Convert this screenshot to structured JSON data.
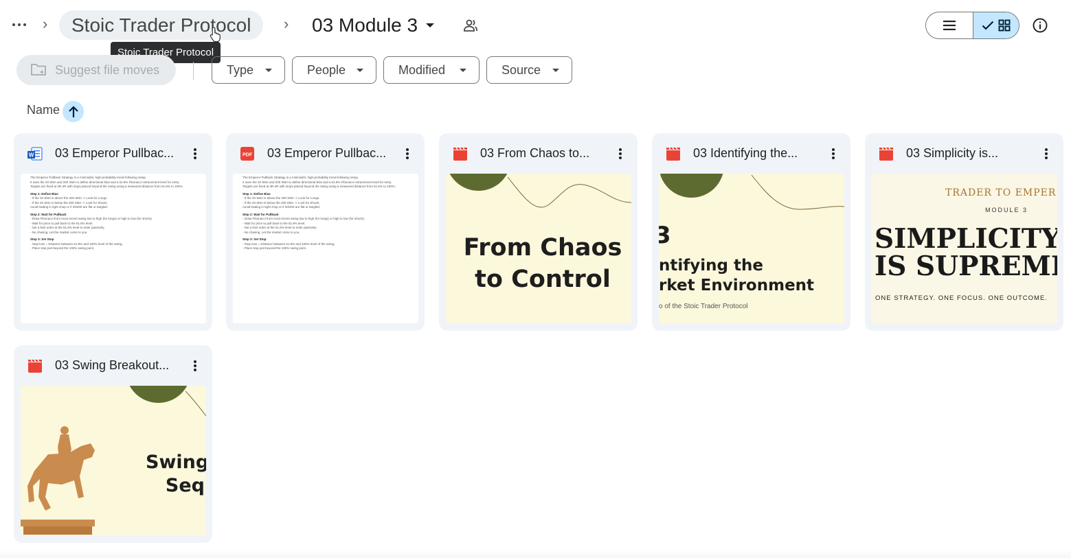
{
  "breadcrumb": {
    "parent": "Stoic Trader Protocol",
    "current": "03 Module 3",
    "tooltip": "Stoic Trader Protocol"
  },
  "toolbar": {
    "suggest_label": "Suggest file moves",
    "filters": [
      "Type",
      "People",
      "Modified",
      "Source"
    ]
  },
  "sort": {
    "label": "Name",
    "direction": "ascending"
  },
  "files": [
    {
      "name": "03 Emperor Pullbac...",
      "type": "word-doc"
    },
    {
      "name": "03 Emperor Pullbac...",
      "type": "pdf"
    },
    {
      "name": "03 From Chaos to...",
      "type": "video"
    },
    {
      "name": "03 Identifying the...",
      "type": "video"
    },
    {
      "name": "03 Simplicity is...",
      "type": "video"
    },
    {
      "name": "03 Swing Breakout...",
      "type": "video"
    }
  ],
  "previews": {
    "doc": [
      {
        "t": "The Emperor Pullback Strategy is a minimalist, high-probability trend-following setup.",
        "b": false
      },
      {
        "t": "It uses the 20 SMA and 200 SMA to define directional bias and a 61.8% Fibonacci retracement level for entry.",
        "b": false
      },
      {
        "t": "Targets are fixed at 3R-4R with stops placed beyond the swing using a measured distance from 61.8% to 100%.",
        "b": false
      },
      {
        "t": "Step 1: Define Bias",
        "b": true
      },
      {
        "t": "- If the 20 SMA is above the 200 SMA -> Look for Longs.",
        "b": false
      },
      {
        "t": "- If the 20 SMA is below the 200 SMA -> Look for Shorts.",
        "b": false
      },
      {
        "t": "Avoid trading in tight chop or if 20/200 are flat or tangled.",
        "b": false
      },
      {
        "t": "Step 2: Wait for Pullback",
        "b": true
      },
      {
        "t": "- Draw Fibonacci from most recent swing low to high (for longs) or high to low (for shorts).",
        "b": false
      },
      {
        "t": "- Wait for price to pull back to the 61.8% level.",
        "b": false
      },
      {
        "t": "- Set a limit order at the 61.8% level to enter passively.",
        "b": false
      },
      {
        "t": "- No chasing. Let the market come to you.",
        "b": false
      },
      {
        "t": "Step 3: Set Stop",
        "b": true
      },
      {
        "t": "- Stop loss = Distance between 61.8% and 100% level of the swing.",
        "b": false
      },
      {
        "t": "- Place stop just beyond the 100% swing point.",
        "b": false
      }
    ],
    "chaos_line1": "From Chaos",
    "chaos_line2": "to Control",
    "identify_num": "3",
    "identify_line1": "ntifying the",
    "identify_line2": "rket Environment",
    "identify_sub": "o of the Stoic Trader Protocol",
    "simp_top": "TRADER TO EMPER",
    "simp_module": "MODULE 3",
    "simp_line1": "SIMPLICITY",
    "simp_line2": "IS SUPREME",
    "simp_tag": "ONE STRATEGY. ONE FOCUS. ONE OUTCOME.",
    "swing_line1": "Swing",
    "swing_line2": "Seq"
  },
  "colors": {
    "accent": "#c2e7ff",
    "card_bg": "#f0f4f9",
    "video_red": "#ea4335",
    "word_blue": "#4285f4",
    "slide_cream": "#fcf8dc",
    "olive": "#5d6b30",
    "statue": "#c98c4e"
  }
}
